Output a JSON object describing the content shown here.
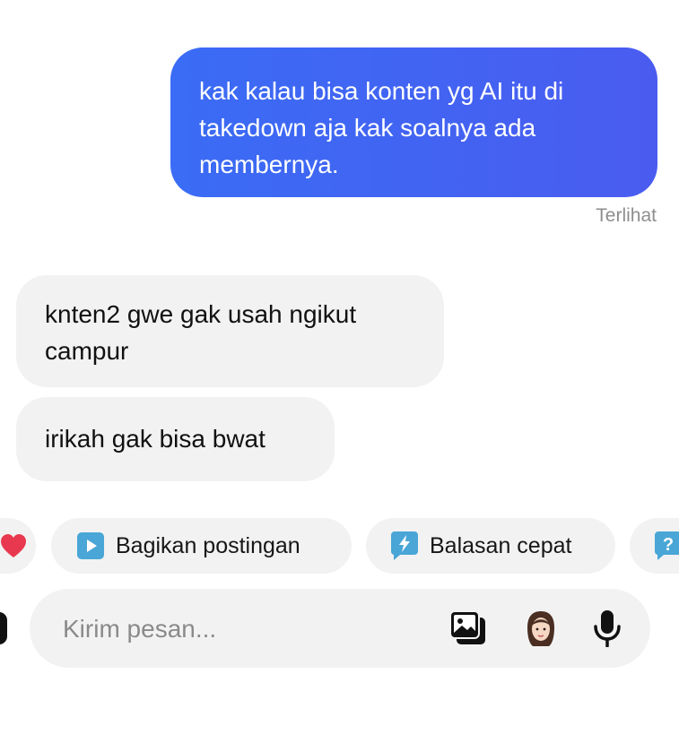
{
  "conversation": {
    "outgoing": [
      {
        "text": "kak kalau bisa konten yg AI itu di takedown aja kak soalnya ada membernya."
      }
    ],
    "status": "Terlihat",
    "incoming": [
      {
        "text": "knten2 gwe gak usah ngikut campur"
      },
      {
        "text": "irikah gak bisa bwat"
      }
    ]
  },
  "suggestions": [
    {
      "label": "",
      "icon": "heart-icon",
      "color": "#e8384f"
    },
    {
      "label": "Bagikan postingan",
      "icon": "share-post-icon",
      "color": "#49a6d6"
    },
    {
      "label": "Balasan cepat",
      "icon": "quick-reply-icon",
      "color": "#49a6d6"
    },
    {
      "label": "",
      "icon": "help-icon",
      "color": "#49a6d6"
    }
  ],
  "composer": {
    "placeholder": "Kirim pesan...",
    "value": "",
    "icons": [
      "gallery-icon",
      "avatar-sticker-icon",
      "microphone-icon"
    ]
  },
  "colors": {
    "outgoing_bubble": "#4464f2",
    "incoming_bubble": "#f2f2f2",
    "accent": "#49a6d6"
  }
}
